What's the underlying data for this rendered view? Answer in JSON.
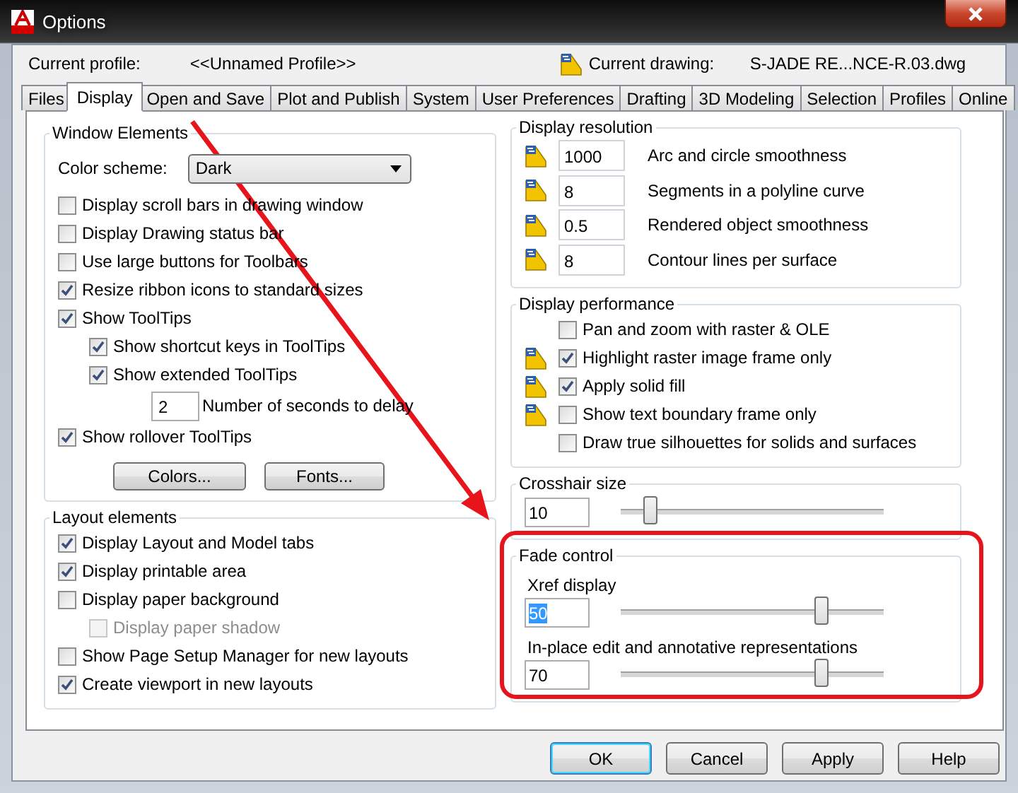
{
  "window": {
    "title": "Options"
  },
  "profile": {
    "label": "Current profile:",
    "value": "<<Unnamed Profile>>"
  },
  "drawing": {
    "label": "Current drawing:",
    "value": "S-JADE RE...NCE-R.03.dwg"
  },
  "tabs": [
    {
      "label": "Files",
      "selected": false
    },
    {
      "label": "Display",
      "selected": true
    },
    {
      "label": "Open and Save",
      "selected": false
    },
    {
      "label": "Plot and Publish",
      "selected": false
    },
    {
      "label": "System",
      "selected": false
    },
    {
      "label": "User Preferences",
      "selected": false
    },
    {
      "label": "Drafting",
      "selected": false
    },
    {
      "label": "3D Modeling",
      "selected": false
    },
    {
      "label": "Selection",
      "selected": false
    },
    {
      "label": "Profiles",
      "selected": false
    },
    {
      "label": "Online",
      "selected": false
    }
  ],
  "window_elements": {
    "title": "Window Elements",
    "color_scheme": {
      "label": "Color scheme:",
      "value": "Dark"
    },
    "options": [
      {
        "kind": "check",
        "label": "Display scroll bars in drawing window",
        "checked": false
      },
      {
        "kind": "check",
        "label": "Display Drawing status bar",
        "checked": false
      },
      {
        "kind": "check",
        "label": "Use large buttons for Toolbars",
        "checked": false
      },
      {
        "kind": "check",
        "label": "Resize ribbon icons to standard sizes",
        "checked": true
      },
      {
        "kind": "check",
        "label": "Show ToolTips",
        "checked": true,
        "children": [
          {
            "kind": "check",
            "label": "Show shortcut keys in ToolTips",
            "checked": true
          },
          {
            "kind": "check",
            "label": "Show extended ToolTips",
            "checked": true,
            "children": [
              {
                "kind": "number",
                "value": "2",
                "label": "Number of seconds to delay"
              }
            ]
          }
        ]
      },
      {
        "kind": "check",
        "label": "Show rollover ToolTips",
        "checked": true
      }
    ],
    "buttons": [
      "Colors...",
      "Fonts..."
    ]
  },
  "layout_elements": {
    "title": "Layout elements",
    "options": [
      {
        "kind": "check",
        "label": "Display Layout and Model tabs",
        "checked": true
      },
      {
        "kind": "check",
        "label": "Display printable area",
        "checked": true
      },
      {
        "kind": "check",
        "label": "Display paper background",
        "checked": false,
        "children": [
          {
            "kind": "check",
            "label": "Display paper shadow",
            "checked": false,
            "disabled": true
          }
        ]
      },
      {
        "kind": "check",
        "label": "Show Page Setup Manager for new layouts",
        "checked": false
      },
      {
        "kind": "check",
        "label": "Create viewport in new layouts",
        "checked": true
      }
    ]
  },
  "display_resolution": {
    "title": "Display resolution",
    "rows": [
      {
        "value": "1000",
        "label": "Arc and circle smoothness",
        "drawing_icon": true
      },
      {
        "value": "8",
        "label": "Segments in a polyline curve",
        "drawing_icon": true
      },
      {
        "value": "0.5",
        "label": "Rendered object smoothness",
        "drawing_icon": true
      },
      {
        "value": "8",
        "label": "Contour lines per surface",
        "drawing_icon": true
      }
    ]
  },
  "display_performance": {
    "title": "Display performance",
    "options": [
      {
        "label": "Pan and zoom with raster & OLE",
        "checked": false,
        "drawing_icon": false
      },
      {
        "label": "Highlight raster image frame only",
        "checked": true,
        "drawing_icon": true
      },
      {
        "label": "Apply solid fill",
        "checked": true,
        "drawing_icon": true
      },
      {
        "label": "Show text boundary frame only",
        "checked": false,
        "drawing_icon": true
      },
      {
        "label": "Draw true silhouettes for solids and surfaces",
        "checked": false,
        "drawing_icon": false
      }
    ]
  },
  "crosshair_size": {
    "title": "Crosshair size",
    "value": "10",
    "level": 0.09
  },
  "fade_control": {
    "title": "Fade control",
    "sliders": [
      {
        "label": "Xref display",
        "value": "50",
        "highlighted": true,
        "level": 0.78
      },
      {
        "label": "In-place edit and annotative representations",
        "value": "70",
        "highlighted": false,
        "level": 0.78
      }
    ]
  },
  "buttons": [
    {
      "label": "OK",
      "default": true
    },
    {
      "label": "Cancel",
      "default": false
    },
    {
      "label": "Apply",
      "default": false
    },
    {
      "label": "Help",
      "default": false
    }
  ]
}
